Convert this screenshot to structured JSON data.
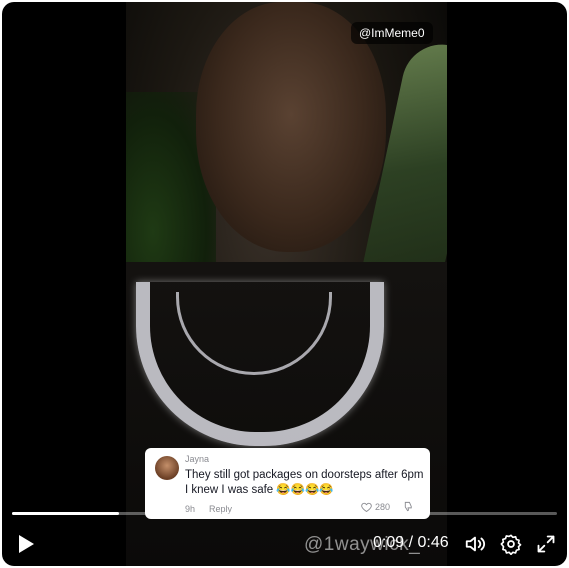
{
  "overlay": {
    "handle": "@ImMeme0"
  },
  "comment": {
    "user": "Jayna",
    "text": "They still got packages on doorsteps after 6pm I knew I was safe 😂😂😂😂",
    "time": "9h",
    "reply_label": "Reply",
    "likes": "280"
  },
  "watermark": "@1waywick_",
  "controls": {
    "time_display": "0:09 / 0:46",
    "progress": 0.196
  },
  "icons": {
    "play": "play-icon",
    "volume": "volume-icon",
    "settings": "gear-icon",
    "fullscreen": "fullscreen-icon",
    "like": "heart-icon",
    "dislike": "thumbs-down-icon"
  },
  "colors": {
    "player_bg": "#000000",
    "comment_bg": "#ffffff",
    "accent": "#ffffff"
  }
}
